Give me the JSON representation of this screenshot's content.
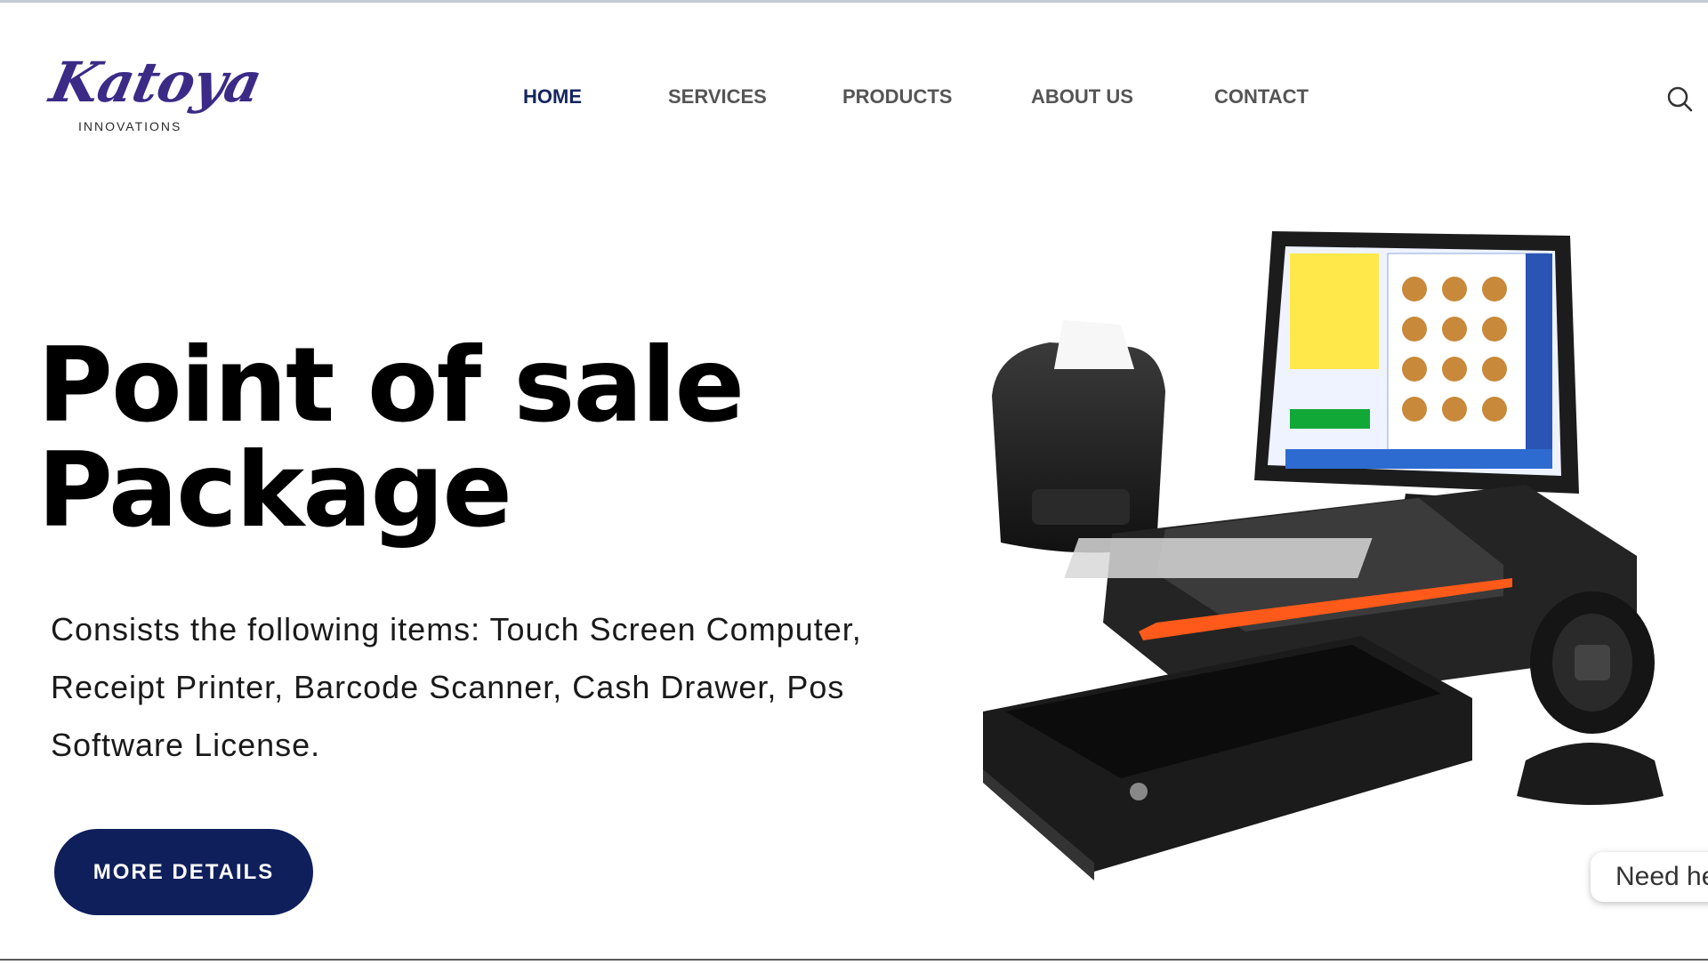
{
  "brand": {
    "name": "Katoya",
    "tagline": "INNOVATIONS"
  },
  "nav": {
    "items": [
      {
        "label": "HOME",
        "active": true
      },
      {
        "label": "SERVICES",
        "active": false
      },
      {
        "label": "PRODUCTS",
        "active": false
      },
      {
        "label": "ABOUT US",
        "active": false
      },
      {
        "label": "CONTACT",
        "active": false
      }
    ],
    "search_icon": "search-icon"
  },
  "hero": {
    "title_line1": "Point of sale",
    "title_line2": "Package",
    "description": "Consists the following items: Touch Screen Computer, Receipt Printer, Barcode Scanner, Cash Drawer, Pos Software License.",
    "cta_label": "MORE DETAILS"
  },
  "chat": {
    "label": "Need he"
  },
  "colors": {
    "brand_navy": "#0f1f5b",
    "nav_active": "#14255e",
    "nav_text": "#555555",
    "logo_purple": "#3b2b86"
  }
}
